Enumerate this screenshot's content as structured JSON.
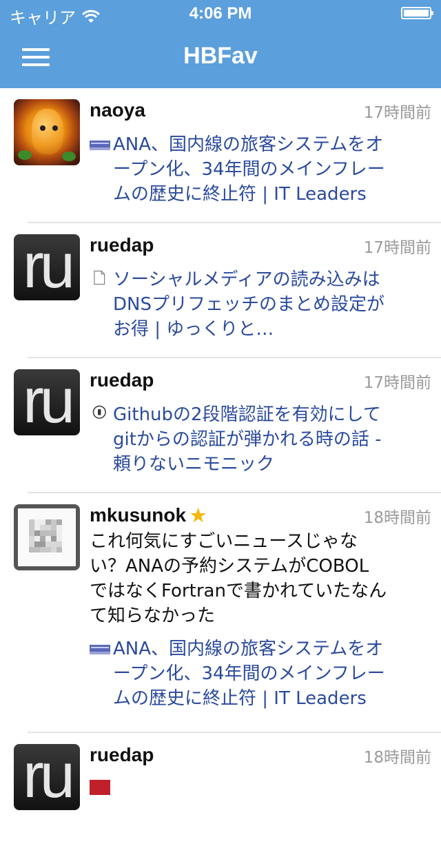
{
  "status_bar": {
    "carrier": "キャリア",
    "time": "4:06 PM"
  },
  "nav": {
    "title": "HBFav"
  },
  "entries": [
    {
      "user": "naoya",
      "time": "17時間前",
      "title_lines": [
        "ANA、国内線の旅客システムをオ",
        "ープン化、34年間のメインフレー",
        "ムの歴史に終止符 | IT Leaders"
      ]
    },
    {
      "user": "ruedap",
      "time": "17時間前",
      "title_lines": [
        "ソーシャルメディアの読み込みは",
        "DNSプリフェッチのまとめ設定が",
        "お得 | ゆっくりと…"
      ]
    },
    {
      "user": "ruedap",
      "time": "17時間前",
      "title_lines": [
        "Githubの2段階認証を有効にして",
        "gitからの認証が弾かれる時の話 -",
        "頼りないニモニック"
      ]
    },
    {
      "user": "mkusunok",
      "time": "18時間前",
      "comment_lines": [
        "これ何気にすごいニュースじゃな",
        "い？ANAの予約システムがCOBOL",
        "ではなくFortranで書かれていたなん",
        "て知らなかった"
      ],
      "title_lines": [
        "ANA、国内線の旅客システムをオ",
        "ープン化、34年間のメインフレー",
        "ムの歴史に終止符 | IT Leaders"
      ]
    },
    {
      "user": "ruedap",
      "time": "18時間前"
    }
  ],
  "colors": {
    "nav": "#5b9fdc",
    "link": "#2a4a9c",
    "timestamp": "#9a9a9a",
    "star": "#f2b90b"
  }
}
